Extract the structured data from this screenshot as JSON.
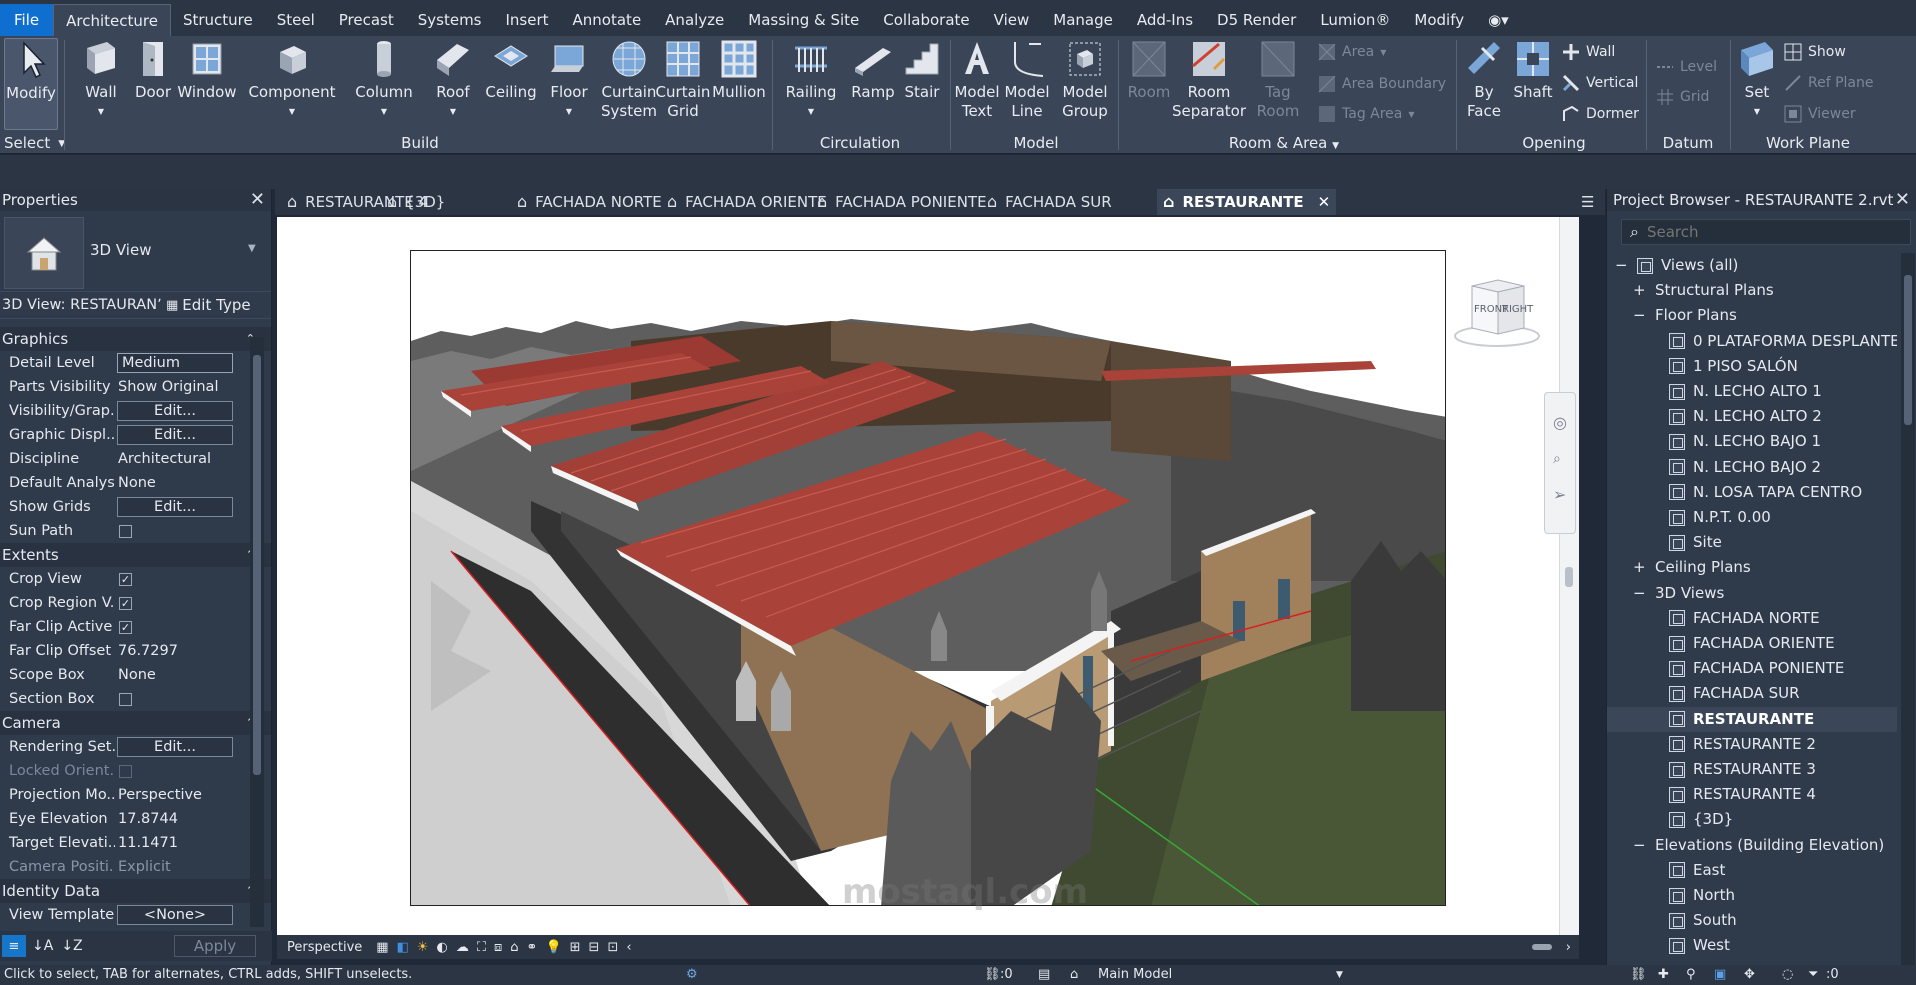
{
  "menu": {
    "tabs": [
      "File",
      "Architecture",
      "Structure",
      "Steel",
      "Precast",
      "Systems",
      "Insert",
      "Annotate",
      "Analyze",
      "Massing & Site",
      "Collaborate",
      "View",
      "Manage",
      "Add-Ins",
      "D5 Render",
      "Lumion®",
      "Modify"
    ],
    "active": "Architecture"
  },
  "ribbon": {
    "select": {
      "modify": "Modify",
      "select": "Select"
    },
    "build": {
      "label": "Build",
      "wall": "Wall",
      "door": "Door",
      "window": "Window",
      "component": "Component",
      "column": "Column",
      "roof": "Roof",
      "ceiling": "Ceiling",
      "floor": "Floor",
      "curtain_system_1": "Curtain",
      "curtain_system_2": "System",
      "curtain_grid_1": "Curtain",
      "curtain_grid_2": "Grid",
      "mullion": "Mullion"
    },
    "circulation": {
      "label": "Circulation",
      "railing": "Railing",
      "ramp": "Ramp",
      "stair": "Stair"
    },
    "model": {
      "label": "Model",
      "text_1": "Model",
      "text_2": "Text",
      "line_1": "Model",
      "line_2": "Line",
      "group_1": "Model",
      "group_2": "Group"
    },
    "room_area": {
      "label": "Room & Area",
      "room": "Room",
      "separator_1": "Room",
      "separator_2": "Separator",
      "tag_1": "Tag",
      "tag_2": "Room",
      "area": "Area",
      "area_boundary": "Area  Boundary",
      "tag_area": "Tag  Area"
    },
    "opening": {
      "label": "Opening",
      "byface_1": "By",
      "byface_2": "Face",
      "shaft": "Shaft",
      "wall": "Wall",
      "vertical": "Vertical",
      "dormer": "Dormer"
    },
    "datum": {
      "label": "Datum",
      "level": "Level",
      "grid": "Grid"
    },
    "workplane": {
      "label": "Work Plane",
      "set": "Set",
      "show": "Show",
      "ref_plane": "Ref  Plane",
      "viewer": "Viewer"
    }
  },
  "properties": {
    "title": "Properties",
    "type_name": "3D View",
    "instance_selector": "3D View: RESTAURANʼ",
    "edit_type": "Edit Type",
    "categories": {
      "graphics": "Graphics",
      "extents": "Extents",
      "camera": "Camera",
      "identity": "Identity Data"
    },
    "rows": {
      "detail_level": {
        "k": "Detail Level",
        "v": "Medium"
      },
      "parts_visibility": {
        "k": "Parts Visibility",
        "v": "Show Original"
      },
      "visibility": {
        "k": "Visibility/Grap...",
        "v": "Edit..."
      },
      "graphic_display": {
        "k": "Graphic Displ...",
        "v": "Edit..."
      },
      "discipline": {
        "k": "Discipline",
        "v": "Architectural"
      },
      "default_analysis": {
        "k": "Default Analys...",
        "v": "None"
      },
      "show_grids": {
        "k": "Show Grids",
        "v": "Edit..."
      },
      "sun_path": {
        "k": "Sun Path"
      },
      "crop_view": {
        "k": "Crop View"
      },
      "crop_region": {
        "k": "Crop Region V..."
      },
      "far_clip_active": {
        "k": "Far Clip Active"
      },
      "far_clip_offset": {
        "k": "Far Clip Offset",
        "v": "76.7297"
      },
      "scope_box": {
        "k": "Scope Box",
        "v": "None"
      },
      "section_box": {
        "k": "Section Box"
      },
      "rendering": {
        "k": "Rendering Set...",
        "v": "Edit..."
      },
      "locked_orient": {
        "k": "Locked Orient..."
      },
      "projection": {
        "k": "Projection Mo...",
        "v": "Perspective"
      },
      "eye_elevation": {
        "k": "Eye Elevation",
        "v": "17.8744"
      },
      "target_elevation": {
        "k": "Target Elevati...",
        "v": "11.1471"
      },
      "camera_position": {
        "k": "Camera Positi...",
        "v": "Explicit"
      },
      "view_template": {
        "k": "View Template",
        "v": "<None>"
      }
    },
    "apply": "Apply"
  },
  "view_tabs": [
    "RESTAURANTE 4",
    "{3D}",
    "FACHADA NORTE",
    "FACHADA ORIENTE",
    "FACHADA PONIENTE",
    "FACHADA SUR",
    "RESTAURANTE"
  ],
  "active_view_tab": "RESTAURANTE",
  "viewcube": {
    "front": "FRONT",
    "right": "RIGHT"
  },
  "viewbar": {
    "mode": "Perspective"
  },
  "watermark": {
    "text": "mostaql.com"
  },
  "browser": {
    "title": "Project Browser - RESTAURANTE 2.rvt",
    "search_placeholder": "Search",
    "views_all": "Views (all)",
    "structural_plans": "Structural Plans",
    "floor_plans": "Floor Plans",
    "floor_items": [
      "0 PLATAFORMA DESPLANTE",
      "1 PISO SALÓN",
      "N. LECHO ALTO 1",
      "N. LECHO ALTO 2",
      "N. LECHO BAJO 1",
      "N. LECHO BAJO 2",
      "N. LOSA TAPA CENTRO",
      "N.P.T. 0.00",
      "Site"
    ],
    "ceiling_plans": "Ceiling Plans",
    "views_3d": "3D Views",
    "views_3d_items": [
      "FACHADA NORTE",
      "FACHADA ORIENTE",
      "FACHADA PONIENTE",
      "FACHADA SUR",
      "RESTAURANTE",
      "RESTAURANTE 2",
      "RESTAURANTE 3",
      "RESTAURANTE 4",
      "{3D}"
    ],
    "elevations": "Elevations (Building Elevation)",
    "elevation_items": [
      "East",
      "North",
      "South",
      "West"
    ]
  },
  "status": {
    "hint": "Click to select, TAB for alternates, CTRL adds, SHIFT unselects.",
    "count_1": ":0",
    "model": "Main Model",
    "count_2": ":0"
  },
  "colors": {
    "accent": "#0e6fd0",
    "ribbon": "#3a4658",
    "panel": "#2f3a4a",
    "roof": "#a9433a",
    "wall": "#8f7253"
  }
}
